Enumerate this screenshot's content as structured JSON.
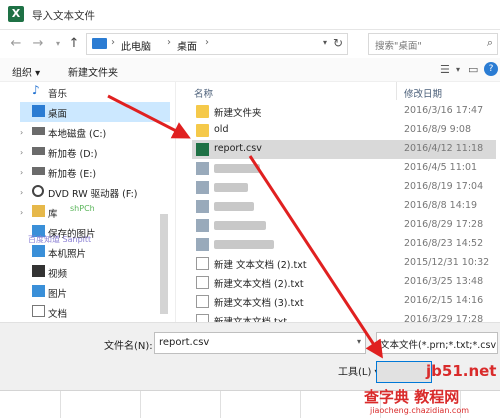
{
  "window": {
    "title": "导入文本文件",
    "app_icon_letter": "X"
  },
  "navigation": {
    "back_icon": "arrow-left-icon",
    "forward_icon": "arrow-right-icon",
    "up_icon": "arrow-up-icon",
    "breadcrumbs": [
      "此电脑",
      "桌面"
    ],
    "search_placeholder": "搜索\"桌面\""
  },
  "toolbar": {
    "organize": "组织 ▾",
    "new_folder": "新建文件夹"
  },
  "sidebar": {
    "items": [
      {
        "label": "音乐",
        "icon": "music-icon",
        "color": "#1e6fd0"
      },
      {
        "label": "桌面",
        "icon": "desktop-icon",
        "color": "#2b7cd3",
        "selected": true
      },
      {
        "label": "本地磁盘 (C:)",
        "icon": "drive-icon",
        "color": "#6b6b6b"
      },
      {
        "label": "新加卷 (D:)",
        "icon": "drive-icon",
        "color": "#6b6b6b"
      },
      {
        "label": "新加卷 (E:)",
        "icon": "drive-icon",
        "color": "#6b6b6b"
      },
      {
        "label": "DVD RW 驱动器 (F:)",
        "icon": "dvd-icon",
        "color": "#444444"
      },
      {
        "label": "库",
        "icon": "library-icon",
        "color": "#e6b84a"
      },
      {
        "label": "保存的图片",
        "icon": "picture-icon",
        "color": "#3a8fd8"
      },
      {
        "label": "本机照片",
        "icon": "picture-icon",
        "color": "#3a8fd8"
      },
      {
        "label": "视频",
        "icon": "video-icon",
        "color": "#333333"
      },
      {
        "label": "图片",
        "icon": "picture-icon",
        "color": "#3a8fd8"
      },
      {
        "label": "文档",
        "icon": "document-icon",
        "color": "#777777"
      }
    ]
  },
  "file_list": {
    "columns": {
      "name": "名称",
      "modified": "修改日期"
    },
    "rows": [
      {
        "name": "新建文件夹",
        "date": "2016/3/16 17:47",
        "type": "folder"
      },
      {
        "name": "old",
        "date": "2016/8/9 9:08",
        "type": "folder"
      },
      {
        "name": "report.csv",
        "date": "2016/4/12 11:18",
        "type": "csv",
        "selected": true
      },
      {
        "name": "",
        "date": "2016/4/5 11:01",
        "type": "blurred"
      },
      {
        "name": "",
        "date": "2016/8/19 17:04",
        "type": "blurred"
      },
      {
        "name": "",
        "date": "2016/8/8 14:19",
        "type": "blurred"
      },
      {
        "name": "",
        "date": "2016/8/29 17:28",
        "type": "blurred"
      },
      {
        "name": "",
        "date": "2016/8/23 14:52",
        "type": "blurred"
      },
      {
        "name": "新建 文本文档 (2).txt",
        "date": "2015/12/31 10:32",
        "type": "text"
      },
      {
        "name": "新建文本文档 (2).txt",
        "date": "2016/3/25 13:48",
        "type": "text"
      },
      {
        "name": "新建文本文档 (3).txt",
        "date": "2016/2/15 14:16",
        "type": "text"
      },
      {
        "name": "新建文本文档.txt",
        "date": "2016/3/29 17:28",
        "type": "text"
      }
    ]
  },
  "footer": {
    "filename_label": "文件名(N):",
    "filename_value": "report.csv",
    "filter_value": "文本文件(*.prn;*.txt;*.csv)",
    "tools_label": "工具(L) ▾"
  },
  "watermark": {
    "line1": "shPCh",
    "line2": "百度知道 Sanpitt"
  },
  "stamp": {
    "site": "jb51.net",
    "brand": "查字典 教程网",
    "url": "jiaocheng.chazidian.com"
  },
  "colors": {
    "annotation_arrow": "#e02020",
    "selection": "#cce8ff",
    "accent": "#0078d7"
  }
}
